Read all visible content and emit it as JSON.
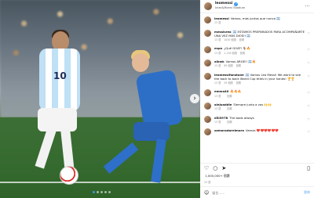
{
  "post": {
    "username": "leomessi",
    "location": "Inter&Miami Stadium",
    "jersey_number": "10",
    "photo_dots_count": 5
  },
  "comments": [
    {
      "user": "leomessi",
      "text": "Vamos, más juntos que nunca 🇦🇷",
      "time": "13 週",
      "likes": "",
      "reply": ""
    },
    {
      "user": "messisrea",
      "text": "🇦🇷 ESTAMOS PREPARADOS PARA ACOMPAÑARTE UNA VEZ MÁS DIOS!! 🇦🇷",
      "time": "13 週",
      "likes": "1000 個讚",
      "reply": "回覆"
    },
    {
      "user": "espn",
      "text": "¿Qué GOAT! 🐐🔥",
      "time": "13 週",
      "likes": "1,126 個讚",
      "reply": "回覆"
    },
    {
      "user": "albwk",
      "text": "Vamos ARGE!! 🇦🇷🔥",
      "time": "13 週",
      "likes": "89 個讚",
      "reply": "回覆"
    },
    {
      "user": "leomessifanstone",
      "text": "🇦🇷 Vamos Leo Messi! We want to see the back to back World Cup titles in your hands! 🏆🏆",
      "time": "13 週",
      "likes": "29 個讚",
      "reply": "回覆"
    },
    {
      "user": "emma40",
      "text": "🔥🔥🔥",
      "time": "13 週",
      "likes": "",
      "reply": "回覆"
    },
    {
      "user": "alejuaddie",
      "text": "Siempre junto a vos 🙌🙌",
      "time": "13 週",
      "likes": "",
      "reply": "回覆"
    },
    {
      "user": "d5l3978",
      "text": "The bads always",
      "time": "13 週",
      "likes": "",
      "reply": "回覆"
    },
    {
      "user": "ozmoradorelmora",
      "text": "Vamos ❤️❤️❤️❤️❤️❤️",
      "time": "",
      "likes": "",
      "reply": ""
    }
  ],
  "actions": {
    "like_icon": "heart-icon",
    "comment_icon": "comment-icon",
    "share_icon": "share-icon",
    "save_icon": "bookmark-icon"
  },
  "likes_text": "‌ 1,000,000+ 個讚",
  "date_text": "13 週",
  "add_comment": {
    "placeholder": "留言……",
    "post_label": "發佈"
  }
}
